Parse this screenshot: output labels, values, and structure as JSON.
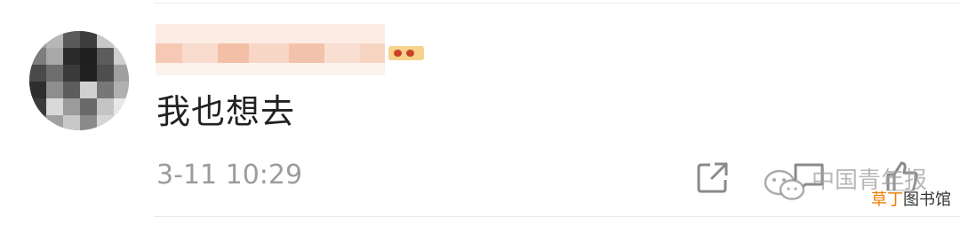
{
  "comment": {
    "text": "我也想去",
    "timestamp": "3-11 10:29"
  },
  "user": {
    "avatar": "pixelated-avatar",
    "username_style": "pixelated-redacted",
    "badge_icon": "vip-badge-icon"
  },
  "actions": [
    {
      "icon": "share-icon",
      "label": ""
    },
    {
      "icon": "comment-icon",
      "label": ""
    },
    {
      "icon": "like-thumb-icon",
      "label": ""
    }
  ],
  "watermark": {
    "icon": "wechat-icon",
    "name": "中国青年报",
    "library_prefix": "草丁",
    "library_suffix": "图书馆"
  },
  "colors": {
    "text_primary": "#222222",
    "text_secondary": "#9c9c9c",
    "icon_gray": "#8a8a8a",
    "accent_orange": "#f07c00"
  }
}
